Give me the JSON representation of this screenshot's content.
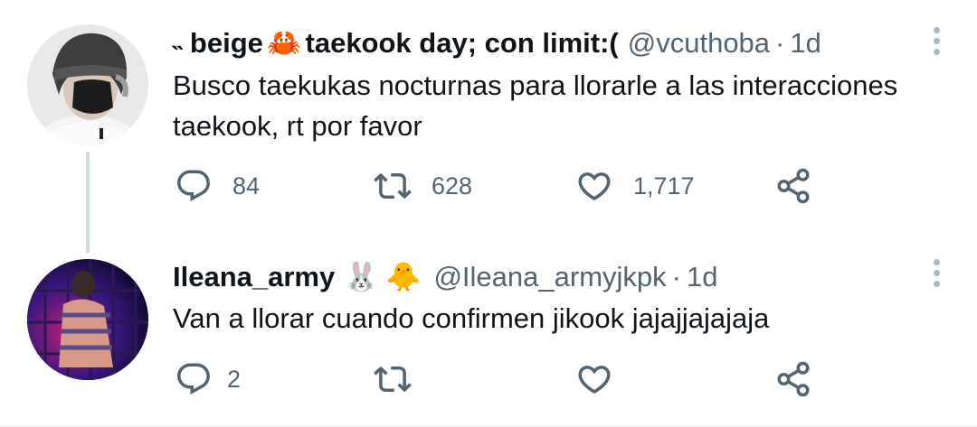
{
  "tweets": [
    {
      "display_name_prefix": "˵ beige",
      "emoji_1": "🦀",
      "display_name_suffix": "taekook day; con limit:(",
      "handle": "@vcuthoba",
      "dot": "·",
      "time": "1d",
      "text": "Busco taekukas nocturnas para llorarle a las interacciones taekook, rt por favor",
      "reply_count": "84",
      "retweet_count": "628",
      "like_count": "1,717"
    },
    {
      "display_name": "Ileana_army",
      "emoji_1": "🐰",
      "emoji_2": "🐥",
      "handle": "@Ileana_armyjkpk",
      "dot": "·",
      "time": "1d",
      "text": "Van a llorar cuando confirmen jikook jajajjajajaja",
      "reply_count": "2",
      "retweet_count": "",
      "like_count": ""
    }
  ],
  "icons": {
    "reply": "reply-icon",
    "retweet": "retweet-icon",
    "like": "heart-icon",
    "share": "share-icon",
    "more": "more-icon"
  },
  "colors": {
    "text": "#0f1419",
    "secondary": "#536471",
    "thread_line": "#cfd9de"
  }
}
